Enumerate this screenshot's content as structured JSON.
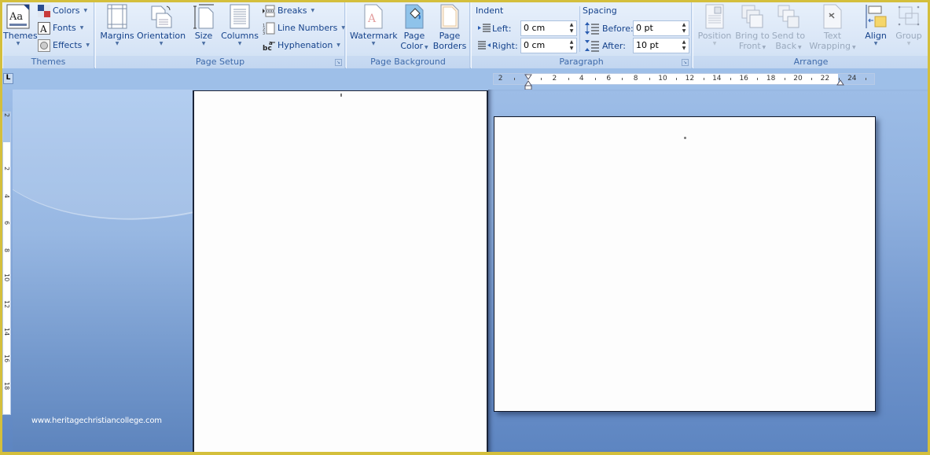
{
  "ribbon": {
    "themes_group": {
      "label": "Themes",
      "themes_button": "Themes",
      "colors": "Colors",
      "fonts": "Fonts",
      "effects": "Effects"
    },
    "page_setup_group": {
      "label": "Page Setup",
      "margins": "Margins",
      "orientation": "Orientation",
      "size": "Size",
      "columns": "Columns",
      "breaks": "Breaks",
      "line_numbers": "Line Numbers",
      "hyphenation": "Hyphenation"
    },
    "page_background_group": {
      "label": "Page Background",
      "watermark": "Watermark",
      "page_color_line1": "Page",
      "page_color_line2": "Color",
      "page_borders_line1": "Page",
      "page_borders_line2": "Borders"
    },
    "paragraph_group": {
      "label": "Paragraph",
      "indent_heading": "Indent",
      "spacing_heading": "Spacing",
      "left_label": "Left:",
      "left_value": "0 cm",
      "right_label": "Right:",
      "right_value": "0 cm",
      "before_label": "Before:",
      "before_value": "0 pt",
      "after_label": "After:",
      "after_value": "10 pt"
    },
    "arrange_group": {
      "label": "Arrange",
      "position": "Position",
      "bring_to_front_line1": "Bring to",
      "bring_to_front_line2": "Front",
      "send_to_back_line1": "Send to",
      "send_to_back_line2": "Back",
      "text_wrapping_line1": "Text",
      "text_wrapping_line2": "Wrapping",
      "align": "Align",
      "group": "Group"
    }
  },
  "horizontal_ruler": {
    "ticks": [
      "2",
      "2",
      "4",
      "6",
      "8",
      "10",
      "12",
      "14",
      "16",
      "18",
      "20",
      "22",
      "24"
    ]
  },
  "vertical_ruler": {
    "ticks": [
      "2",
      "2",
      "4",
      "6",
      "8",
      "10",
      "12",
      "14",
      "16",
      "18"
    ]
  },
  "watermark_url": "www.heritagechristiancollege.com",
  "colors": {
    "ribbon_text": "#15428b",
    "workspace_blue": "#6f94cb",
    "frame_border": "#d4bf3c"
  }
}
